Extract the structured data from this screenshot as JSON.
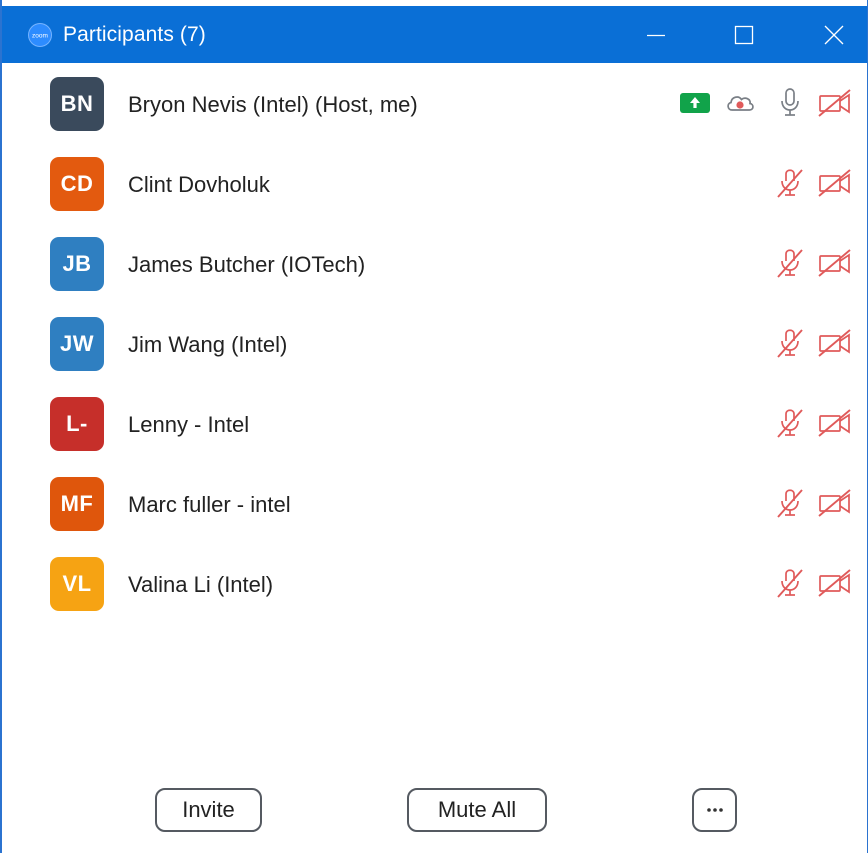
{
  "window": {
    "title": "Participants (7)",
    "logo_text": "zoom",
    "accent_color": "#0a6fd6"
  },
  "participants": [
    {
      "initials": "BN",
      "name": "Bryon Nevis (Intel) (Host, me)",
      "avatar_color": "#3a4a5c",
      "icons": [
        "share-screen-icon",
        "cloud-record-icon",
        "mic-on-icon",
        "video-off-icon"
      ]
    },
    {
      "initials": "CD",
      "name": "Clint Dovholuk",
      "avatar_color": "#e35a0f",
      "icons": [
        "mic-muted-icon",
        "video-off-icon"
      ]
    },
    {
      "initials": "JB",
      "name": "James Butcher (IOTech)",
      "avatar_color": "#2f7fc1",
      "icons": [
        "mic-muted-icon",
        "video-off-icon"
      ]
    },
    {
      "initials": "JW",
      "name": "Jim Wang (Intel)",
      "avatar_color": "#2f7fc1",
      "icons": [
        "mic-muted-icon",
        "video-off-icon"
      ]
    },
    {
      "initials": "L-",
      "name": "Lenny - Intel",
      "avatar_color": "#c62f2a",
      "icons": [
        "mic-muted-icon",
        "video-off-icon"
      ]
    },
    {
      "initials": "MF",
      "name": "Marc fuller - intel",
      "avatar_color": "#df560c",
      "icons": [
        "mic-muted-icon",
        "video-off-icon"
      ]
    },
    {
      "initials": "VL",
      "name": "Valina Li (Intel)",
      "avatar_color": "#f6a313",
      "icons": [
        "mic-muted-icon",
        "video-off-icon"
      ]
    }
  ],
  "footer": {
    "invite_label": "Invite",
    "mute_all_label": "Mute All",
    "more_label": "···"
  },
  "colors": {
    "muted_red": "#e05a5a",
    "share_green": "#11a34a",
    "icon_gray": "#7a7f86"
  }
}
